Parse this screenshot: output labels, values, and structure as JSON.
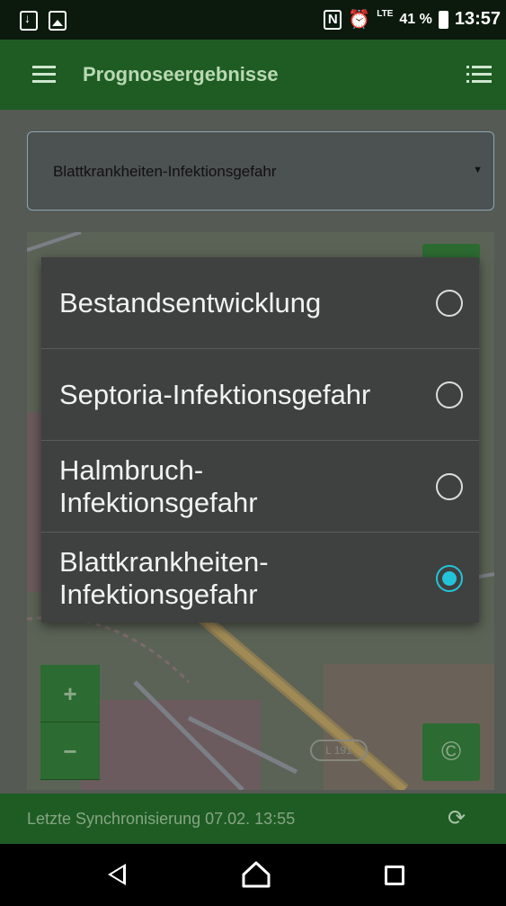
{
  "status_bar": {
    "battery": "41 %",
    "time": "13:57",
    "signal": "LTE",
    "icons": [
      "download-icon",
      "image-icon",
      "nfc-icon",
      "alarm-icon",
      "signal-icon",
      "battery-icon"
    ]
  },
  "app_bar": {
    "title": "Prognoseergebnisse",
    "left_icon": "menu-icon",
    "right_icon": "list-icon"
  },
  "select": {
    "value": "Blattkrankheiten-Infektionsgefahr",
    "arrow": "▼"
  },
  "dropdown": {
    "options": [
      {
        "label": "Bestandsentwicklung",
        "selected": false
      },
      {
        "label": "Septoria-Infektionsgefahr",
        "selected": false
      },
      {
        "label": "Halmbruch-\nInfektionsgefahr",
        "selected": false
      },
      {
        "label": "Blattkrankheiten-\nInfektionsgefahr",
        "selected": true
      }
    ],
    "accent": "#22c4d9"
  },
  "map": {
    "zoom_in": "+",
    "zoom_out": "−",
    "copyright": "©",
    "road_label": "L 191"
  },
  "footer": {
    "sync_text": "Letzte Synchronisierung 07.02. 13:55",
    "sync_icon": "sync-icon"
  },
  "colors": {
    "app_bar": "#1e5c23",
    "status_bar": "#0c1a0d"
  }
}
